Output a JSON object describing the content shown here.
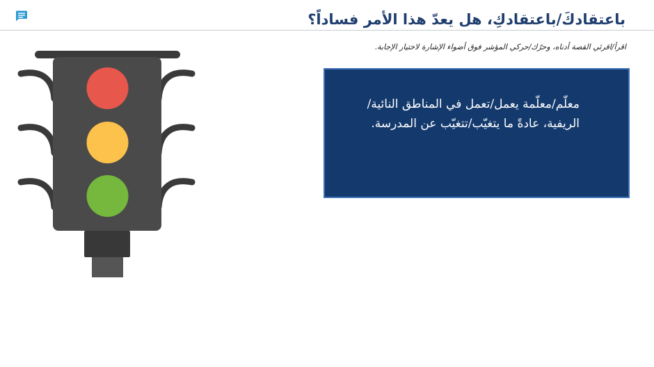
{
  "header": {
    "title": "باعتقادكَ/باعتقادكِ، هل يعدّ هذا الأمر فساداً؟",
    "comment_icon": "comment-icon"
  },
  "instruction": "اقرأ/اقرئي القصة أدناه، وحرّك/حركي المؤشر فوق أضواء الإشارة لاختيار الإجابة.",
  "traffic_light": {
    "lights": [
      {
        "name": "red",
        "color": "#e8574c"
      },
      {
        "name": "yellow",
        "color": "#fcc24b"
      },
      {
        "name": "green",
        "color": "#76b83e"
      }
    ],
    "body_color": "#4a4a4a",
    "base_color": "#383838"
  },
  "story": {
    "text": "معلّم/معلّمة يعمل/تعمل في المناطق النائية/ الريفية، عادةً ما يتغيّب/تتغيّب عن المدرسة.",
    "background": "#143a6d"
  }
}
